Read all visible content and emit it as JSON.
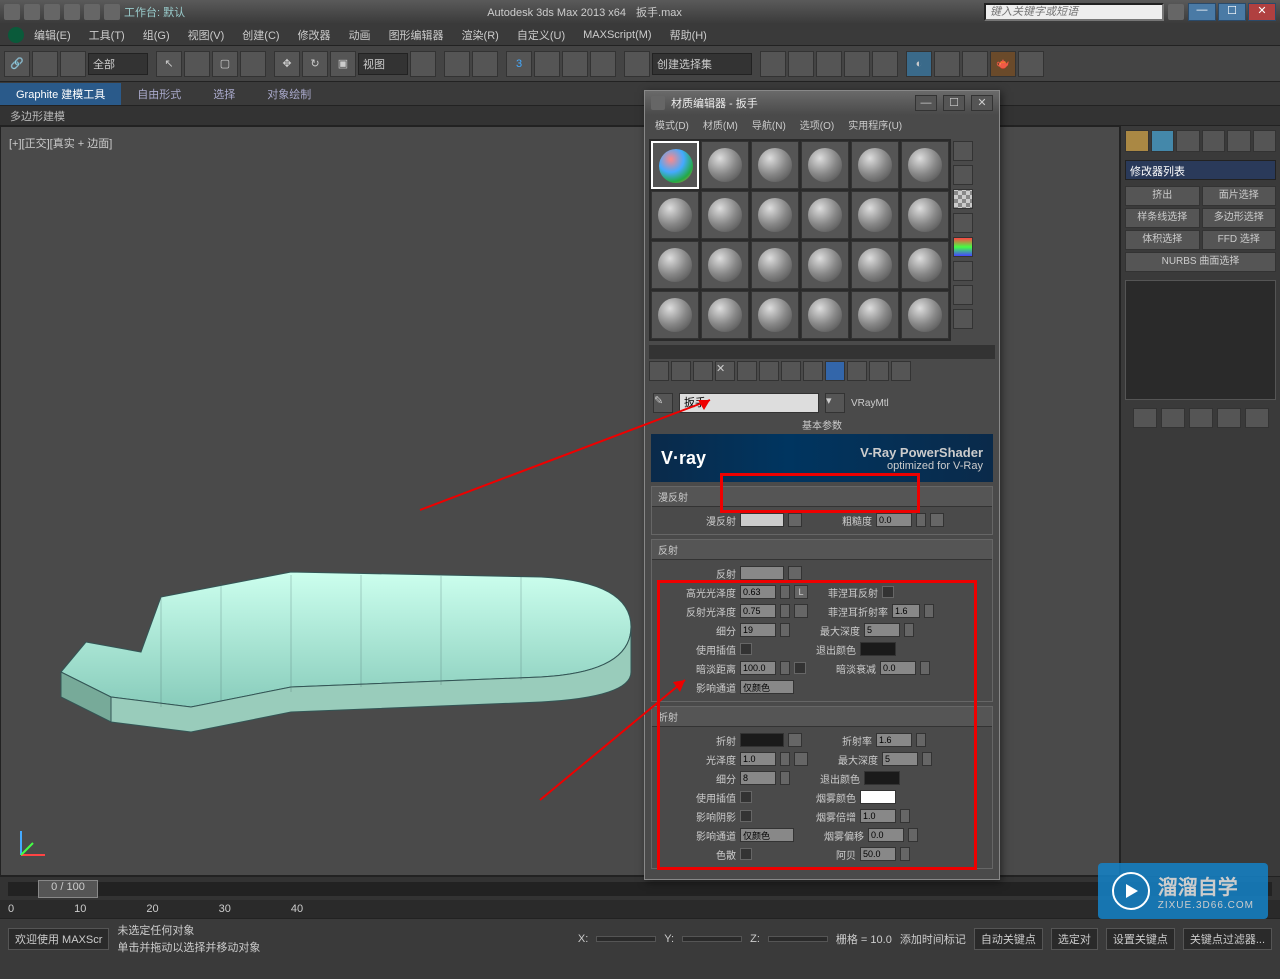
{
  "titlebar": {
    "workspace_label": "工作台: 默认",
    "app": "Autodesk 3ds Max  2013 x64",
    "file": "扳手.max",
    "search_placeholder": "键入关键字或短语"
  },
  "menus": [
    "编辑(E)",
    "工具(T)",
    "组(G)",
    "视图(V)",
    "创建(C)",
    "修改器",
    "动画",
    "图形编辑器",
    "渲染(R)",
    "自定义(U)",
    "MAXScript(M)",
    "帮助(H)"
  ],
  "toolbar": {
    "select_filter": "全部",
    "ref_coord": "视图",
    "create_set": "创建选择集"
  },
  "ribbon": {
    "tabs": [
      "Graphite 建模工具",
      "自由形式",
      "选择",
      "对象绘制"
    ],
    "sub": "多边形建模"
  },
  "viewport": {
    "label": "[+][正交][真实 + 边面]"
  },
  "right_panel": {
    "modifier_list": "修改器列表",
    "buttons": [
      "挤出",
      "面片选择",
      "样条线选择",
      "多边形选择",
      "体积选择",
      "FFD 选择"
    ],
    "nurbs": "NURBS 曲面选择"
  },
  "timeline": {
    "pos": "0 / 100"
  },
  "status": {
    "welcome": "欢迎使用  MAXScr",
    "sel": "未选定任何对象",
    "hint": "单击并拖动以选择并移动对象",
    "x": "X:",
    "y": "Y:",
    "z": "Z:",
    "grid": "栅格 = 10.0",
    "addtime": "添加时间标记",
    "autokey": "自动关键点",
    "selkey": "选定对",
    "setkey": "设置关键点",
    "keyfilter": "关键点过滤器..."
  },
  "mat_editor": {
    "title": "材质编辑器 - 扳手",
    "menus": [
      "模式(D)",
      "材质(M)",
      "导航(N)",
      "选项(O)",
      "实用程序(U)"
    ],
    "name": "扳手",
    "type": "VRayMtl",
    "basic_params": "基本参数",
    "vray": {
      "logo": "V·ray",
      "title": "V-Ray PowerShader",
      "sub": "optimized for V-Ray"
    },
    "diffuse": {
      "title": "漫反射",
      "label": "漫反射",
      "rough_label": "粗糙度",
      "rough": "0.0"
    },
    "reflect": {
      "title": "反射",
      "label": "反射",
      "hilight_label": "高光光泽度",
      "hilight": "0.63",
      "l_btn": "L",
      "fresnel_label": "菲涅耳反射",
      "refl_gloss_label": "反射光泽度",
      "refl_gloss": "0.75",
      "fresnel_ior_label": "菲涅耳折射率",
      "fresnel_ior": "1.6",
      "subdiv_label": "细分",
      "subdiv": "19",
      "maxdepth_label": "最大深度",
      "maxdepth": "5",
      "interp_label": "使用插值",
      "exitcolor_label": "退出颜色",
      "dimdist_label": "暗淡距离",
      "dimdist": "100.0",
      "dimfall_label": "暗淡衰减",
      "dimfall": "0.0",
      "affect_label": "影响通道",
      "affect": "仅颜色"
    },
    "refract": {
      "title": "折射",
      "label": "折射",
      "ior_label": "折射率",
      "ior": "1.6",
      "gloss_label": "光泽度",
      "gloss": "1.0",
      "maxdepth_label": "最大深度",
      "maxdepth": "5",
      "subdiv_label": "细分",
      "subdiv": "8",
      "exitcolor_label": "退出颜色",
      "interp_label": "使用插值",
      "fogcolor_label": "烟雾颜色",
      "shadow_label": "影响阴影",
      "fogmult_label": "烟雾倍增",
      "fogmult": "1.0",
      "affect_label": "影响通道",
      "affect": "仅颜色",
      "fogbias_label": "烟雾偏移",
      "fogbias": "0.0",
      "disp_label": "色散",
      "abbe_label": "阿贝",
      "abbe": "50.0"
    }
  },
  "watermark": {
    "big": "溜溜自学",
    "small": "ZIXUE.3D66.COM"
  }
}
